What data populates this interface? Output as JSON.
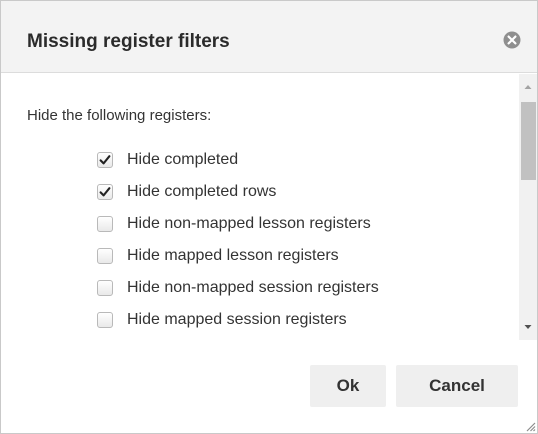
{
  "dialog": {
    "title": "Missing register filters",
    "close_icon": "close-circle-icon"
  },
  "content": {
    "prompt": "Hide the following registers:",
    "options": [
      {
        "label": "Hide completed",
        "checked": true
      },
      {
        "label": "Hide completed rows",
        "checked": true
      },
      {
        "label": "Hide non-mapped lesson registers",
        "checked": false
      },
      {
        "label": "Hide mapped lesson registers",
        "checked": false
      },
      {
        "label": "Hide non-mapped session registers",
        "checked": false
      },
      {
        "label": "Hide mapped session registers",
        "checked": false
      }
    ]
  },
  "footer": {
    "ok_label": "Ok",
    "cancel_label": "Cancel"
  },
  "colors": {
    "titlebar_bg": "#f3f3f3",
    "button_bg": "#efefef",
    "text": "#333333"
  }
}
